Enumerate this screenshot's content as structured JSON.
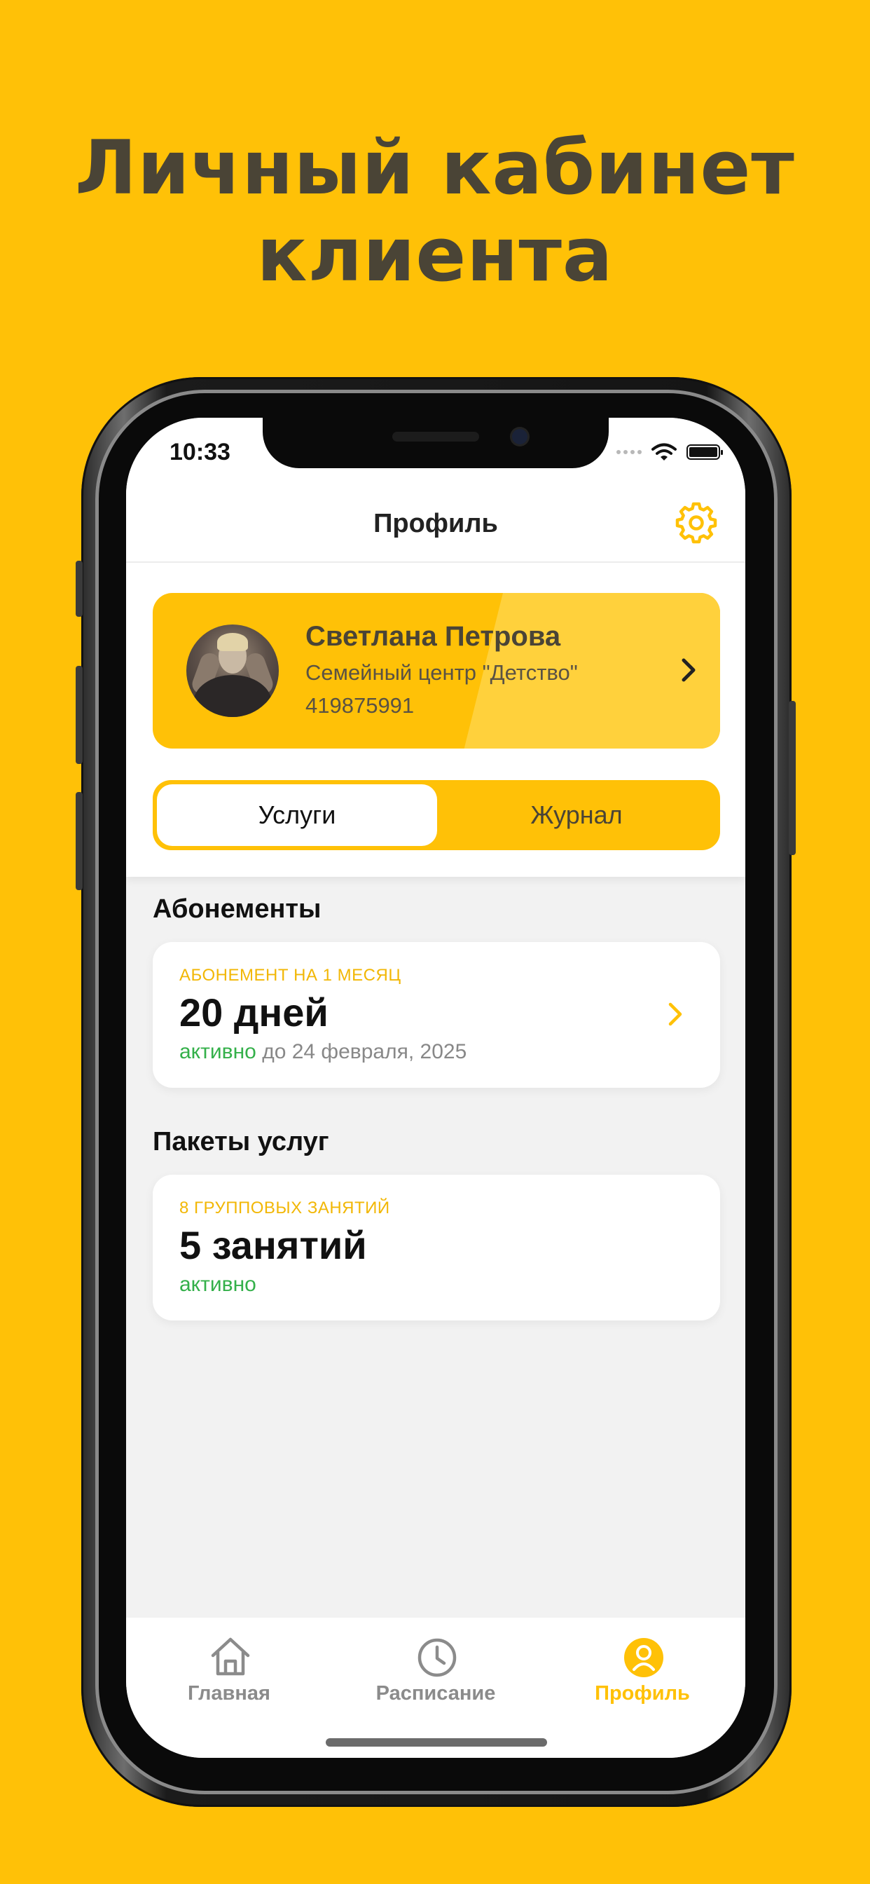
{
  "promo": {
    "line1": "Личный кабинет",
    "line2": "клиента"
  },
  "status_bar": {
    "time": "10:33",
    "icons": [
      "signal-icon",
      "wifi-icon",
      "battery-icon"
    ]
  },
  "nav": {
    "title": "Профиль",
    "settings_icon": "gear-icon"
  },
  "profile": {
    "name": "Светлана Петрова",
    "organization": "Семейный центр \"Детство\"",
    "id": "419875991"
  },
  "segment": {
    "tabs": [
      "Услуги",
      "Журнал"
    ],
    "selected": "Услуги"
  },
  "subscriptions": {
    "title": "Абонементы",
    "items": [
      {
        "caption": "АБОНЕМЕНТ НА 1 МЕСЯЦ",
        "value": "20 дней",
        "status": "активно",
        "until": "до 24 февраля, 2025"
      }
    ]
  },
  "packages": {
    "title": "Пакеты услуг",
    "items": [
      {
        "caption": "8 ГРУППОВЫХ ЗАНЯТИЙ",
        "value": "5 занятий",
        "status": "активно"
      }
    ]
  },
  "tabbar": {
    "items": [
      {
        "label": "Главная",
        "icon": "home-icon"
      },
      {
        "label": "Расписание",
        "icon": "clock-icon"
      },
      {
        "label": "Профиль",
        "icon": "profile-icon"
      }
    ],
    "active": "Профиль"
  },
  "colors": {
    "accent": "#FFC107",
    "status_active": "#34B04A",
    "caption": "#F2B705",
    "text_dark": "#4a4436"
  }
}
